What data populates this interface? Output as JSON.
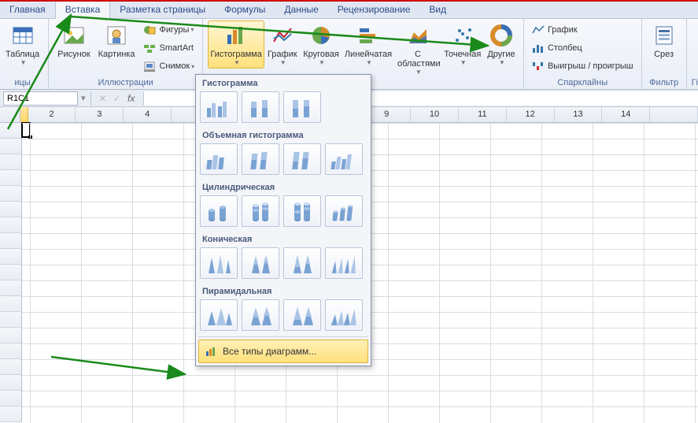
{
  "tabs": {
    "home": "Главная",
    "insert": "Вставка",
    "page_layout": "Разметка страницы",
    "formulas": "Формулы",
    "data": "Данные",
    "review": "Рецензирование",
    "view": "Вид"
  },
  "ribbon": {
    "tables": {
      "label": "ицы",
      "table": "Таблица"
    },
    "illustrations": {
      "label": "Иллюстрации",
      "picture": "Рисунок",
      "clipart": "Картинка",
      "shapes": "Фигуры",
      "smartart": "SmartArt",
      "screenshot": "Снимок"
    },
    "charts": {
      "column": "Гистограмма",
      "line": "График",
      "pie": "Круговая",
      "bar": "Линейчатая",
      "area": "С областями",
      "scatter": "Точечная",
      "other": "Другие"
    },
    "sparklines": {
      "label": "Спарклайны",
      "line": "График",
      "column": "Столбец",
      "winloss": "Выигрыш / проигрыш"
    },
    "filter": {
      "label": "Фильтр",
      "slicer": "Срез"
    }
  },
  "namebox": {
    "value": "R1C1",
    "fx": "fx"
  },
  "columns": [
    "",
    "2",
    "3",
    "4",
    "",
    "",
    "",
    "",
    "9",
    "10",
    "11",
    "12",
    "13",
    "14",
    ""
  ],
  "dropdown": {
    "s1": "Гистограмма",
    "s2": "Объемная гистограмма",
    "s3": "Цилиндрическая",
    "s4": "Коническая",
    "s5": "Пирамидальная",
    "footer": "Все типы диаграмм..."
  }
}
